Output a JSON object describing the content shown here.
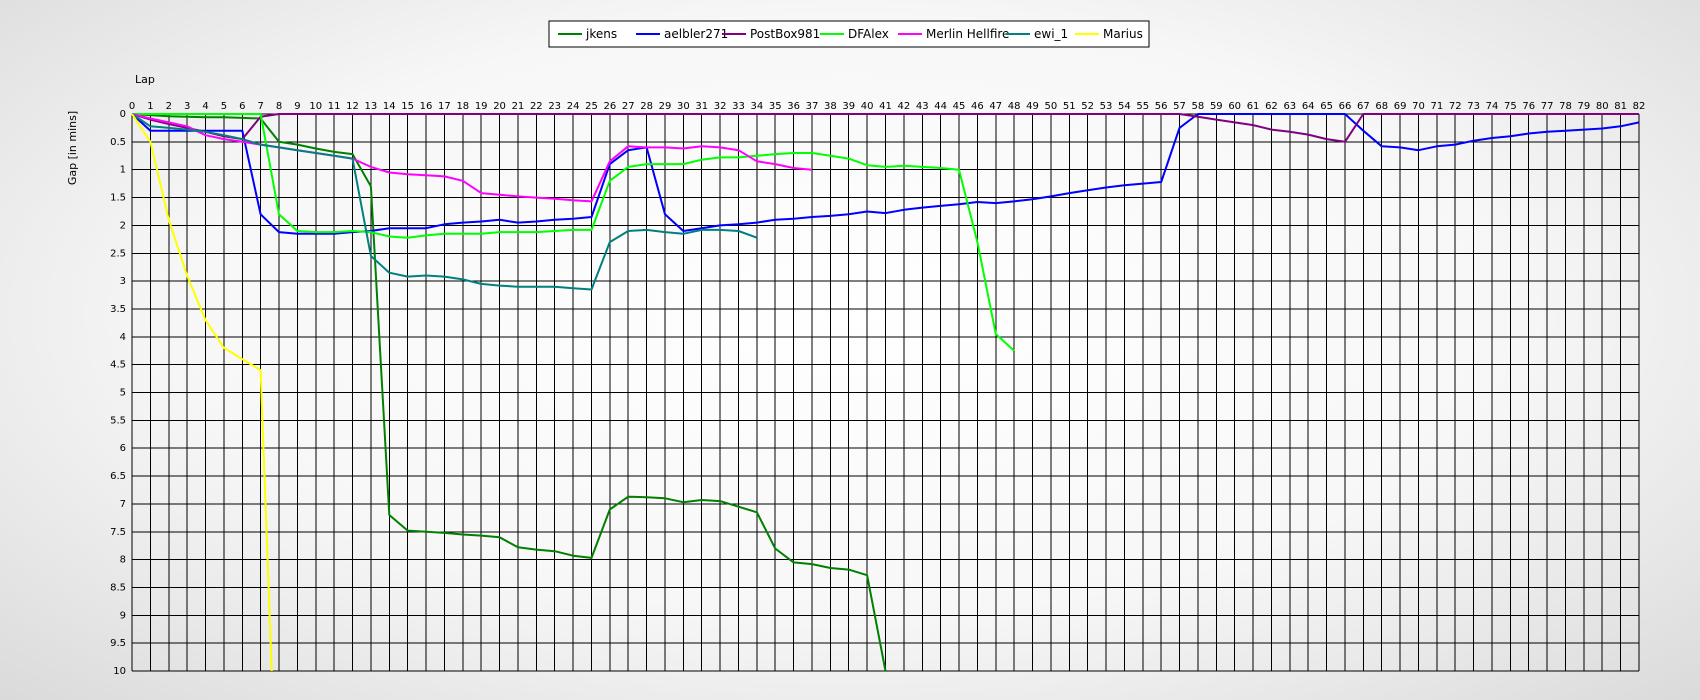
{
  "chart_data": {
    "type": "line",
    "title": "",
    "xlabel": "Lap",
    "ylabel": "Gap [in mins]",
    "xlim": [
      0,
      82
    ],
    "ylim": [
      0,
      10
    ],
    "y_inverted": true,
    "x_ticks": [
      0,
      1,
      2,
      3,
      4,
      5,
      6,
      7,
      8,
      9,
      10,
      11,
      12,
      13,
      14,
      15,
      16,
      17,
      18,
      19,
      20,
      21,
      22,
      23,
      24,
      25,
      26,
      27,
      28,
      29,
      30,
      31,
      32,
      33,
      34,
      35,
      36,
      37,
      38,
      39,
      40,
      41,
      42,
      43,
      44,
      45,
      46,
      47,
      48,
      49,
      50,
      51,
      52,
      53,
      54,
      55,
      56,
      57,
      58,
      59,
      60,
      61,
      62,
      63,
      64,
      65,
      66,
      67,
      68,
      69,
      70,
      71,
      72,
      73,
      74,
      75,
      76,
      77,
      78,
      79,
      80,
      81,
      82
    ],
    "y_ticks": [
      "0",
      "0.5",
      "1",
      "1.5",
      "2",
      "2.5",
      "3",
      "3.5",
      "4",
      "4.5",
      "5",
      "5.5",
      "6",
      "6.5",
      "7",
      "7.5",
      "8",
      "8.5",
      "9",
      "9.5",
      "10"
    ],
    "grid": true,
    "legend_position": "top-center",
    "series": [
      {
        "name": "jkens",
        "color": "#008000",
        "points": [
          [
            0,
            0
          ],
          [
            1,
            0.02
          ],
          [
            2,
            0.04
          ],
          [
            3,
            0.05
          ],
          [
            4,
            0.06
          ],
          [
            5,
            0.06
          ],
          [
            6,
            0.07
          ],
          [
            7,
            0.08
          ],
          [
            8,
            0.5
          ],
          [
            9,
            0.55
          ],
          [
            10,
            0.62
          ],
          [
            11,
            0.68
          ],
          [
            12,
            0.72
          ],
          [
            13,
            1.3
          ],
          [
            14,
            7.2
          ],
          [
            15,
            7.48
          ],
          [
            16,
            7.5
          ],
          [
            17,
            7.52
          ],
          [
            18,
            7.55
          ],
          [
            19,
            7.57
          ],
          [
            20,
            7.6
          ],
          [
            21,
            7.78
          ],
          [
            22,
            7.82
          ],
          [
            23,
            7.85
          ],
          [
            24,
            7.93
          ],
          [
            25,
            7.97
          ],
          [
            26,
            7.1
          ],
          [
            27,
            6.87
          ],
          [
            28,
            6.88
          ],
          [
            29,
            6.9
          ],
          [
            30,
            6.97
          ],
          [
            31,
            6.93
          ],
          [
            32,
            6.95
          ],
          [
            33,
            7.05
          ],
          [
            34,
            7.15
          ],
          [
            35,
            7.8
          ],
          [
            36,
            8.05
          ],
          [
            37,
            8.08
          ],
          [
            38,
            8.15
          ],
          [
            39,
            8.18
          ],
          [
            40,
            8.28
          ],
          [
            41,
            10
          ]
        ]
      },
      {
        "name": "aelbler271",
        "color": "#0000ff",
        "points": [
          [
            0,
            0
          ],
          [
            1,
            0.3
          ],
          [
            2,
            0.3
          ],
          [
            3,
            0.3
          ],
          [
            4,
            0.3
          ],
          [
            5,
            0.3
          ],
          [
            6,
            0.3
          ],
          [
            7,
            1.8
          ],
          [
            8,
            2.12
          ],
          [
            9,
            2.15
          ],
          [
            10,
            2.15
          ],
          [
            11,
            2.15
          ],
          [
            12,
            2.12
          ],
          [
            13,
            2.1
          ],
          [
            14,
            2.05
          ],
          [
            15,
            2.05
          ],
          [
            16,
            2.05
          ],
          [
            17,
            1.98
          ],
          [
            18,
            1.95
          ],
          [
            19,
            1.93
          ],
          [
            20,
            1.9
          ],
          [
            21,
            1.95
          ],
          [
            22,
            1.93
          ],
          [
            23,
            1.9
          ],
          [
            24,
            1.88
          ],
          [
            25,
            1.85
          ],
          [
            26,
            0.9
          ],
          [
            27,
            0.65
          ],
          [
            28,
            0.6
          ],
          [
            29,
            1.8
          ],
          [
            30,
            2.1
          ],
          [
            31,
            2.05
          ],
          [
            32,
            2
          ],
          [
            33,
            1.98
          ],
          [
            34,
            1.95
          ],
          [
            35,
            1.9
          ],
          [
            36,
            1.88
          ],
          [
            37,
            1.85
          ],
          [
            38,
            1.83
          ],
          [
            39,
            1.8
          ],
          [
            40,
            1.75
          ],
          [
            41,
            1.78
          ],
          [
            42,
            1.72
          ],
          [
            43,
            1.68
          ],
          [
            44,
            1.65
          ],
          [
            45,
            1.62
          ],
          [
            46,
            1.58
          ],
          [
            47,
            1.6
          ],
          [
            48,
            1.57
          ],
          [
            49,
            1.53
          ],
          [
            50,
            1.48
          ],
          [
            51,
            1.42
          ],
          [
            52,
            1.37
          ],
          [
            53,
            1.32
          ],
          [
            54,
            1.28
          ],
          [
            55,
            1.25
          ],
          [
            56,
            1.22
          ],
          [
            57,
            0.25
          ],
          [
            58,
            0
          ],
          [
            59,
            0
          ],
          [
            60,
            0
          ],
          [
            61,
            0
          ],
          [
            62,
            0
          ],
          [
            63,
            0
          ],
          [
            64,
            0
          ],
          [
            65,
            0
          ],
          [
            66,
            0
          ],
          [
            67,
            0.3
          ],
          [
            68,
            0.58
          ],
          [
            69,
            0.6
          ],
          [
            70,
            0.65
          ],
          [
            71,
            0.58
          ],
          [
            72,
            0.55
          ],
          [
            73,
            0.48
          ],
          [
            74,
            0.43
          ],
          [
            75,
            0.4
          ],
          [
            76,
            0.35
          ],
          [
            77,
            0.32
          ],
          [
            78,
            0.3
          ],
          [
            79,
            0.28
          ],
          [
            80,
            0.26
          ],
          [
            81,
            0.22
          ],
          [
            82,
            0.15
          ]
        ]
      },
      {
        "name": "PostBox981",
        "color": "#800080",
        "points": [
          [
            0,
            0
          ],
          [
            1,
            0.1
          ],
          [
            2,
            0.18
          ],
          [
            3,
            0.25
          ],
          [
            4,
            0.32
          ],
          [
            5,
            0.4
          ],
          [
            6,
            0.45
          ],
          [
            7,
            0.05
          ],
          [
            8,
            0
          ],
          [
            57,
            0
          ],
          [
            58,
            0.05
          ],
          [
            59,
            0.1
          ],
          [
            60,
            0.15
          ],
          [
            61,
            0.2
          ],
          [
            62,
            0.28
          ],
          [
            63,
            0.32
          ],
          [
            64,
            0.37
          ],
          [
            65,
            0.45
          ],
          [
            66,
            0.5
          ],
          [
            67,
            0
          ],
          [
            82,
            0
          ]
        ]
      },
      {
        "name": "DFAlex",
        "color": "#00ff00",
        "points": [
          [
            0,
            0
          ],
          [
            1,
            0
          ],
          [
            2,
            0
          ],
          [
            3,
            0
          ],
          [
            4,
            0
          ],
          [
            5,
            0
          ],
          [
            6,
            0
          ],
          [
            7,
            0
          ],
          [
            8,
            1.8
          ],
          [
            9,
            2.1
          ],
          [
            10,
            2.12
          ],
          [
            11,
            2.12
          ],
          [
            12,
            2.1
          ],
          [
            13,
            2.12
          ],
          [
            14,
            2.2
          ],
          [
            15,
            2.22
          ],
          [
            16,
            2.18
          ],
          [
            17,
            2.15
          ],
          [
            18,
            2.15
          ],
          [
            19,
            2.15
          ],
          [
            20,
            2.12
          ],
          [
            21,
            2.12
          ],
          [
            22,
            2.12
          ],
          [
            23,
            2.1
          ],
          [
            24,
            2.08
          ],
          [
            25,
            2.08
          ],
          [
            26,
            1.2
          ],
          [
            27,
            0.95
          ],
          [
            28,
            0.9
          ],
          [
            29,
            0.9
          ],
          [
            30,
            0.9
          ],
          [
            31,
            0.82
          ],
          [
            32,
            0.78
          ],
          [
            33,
            0.78
          ],
          [
            34,
            0.75
          ],
          [
            35,
            0.72
          ],
          [
            36,
            0.7
          ],
          [
            37,
            0.7
          ],
          [
            38,
            0.75
          ],
          [
            39,
            0.8
          ],
          [
            40,
            0.92
          ],
          [
            41,
            0.95
          ],
          [
            42,
            0.93
          ],
          [
            43,
            0.95
          ],
          [
            44,
            0.97
          ],
          [
            45,
            1
          ],
          [
            46,
            2.3
          ],
          [
            47,
            3.95
          ],
          [
            48,
            4.25
          ]
        ]
      },
      {
        "name": "Merlin Hellfire",
        "color": "#ff00ff",
        "points": [
          [
            0,
            0
          ],
          [
            1,
            0.08
          ],
          [
            2,
            0.15
          ],
          [
            3,
            0.22
          ],
          [
            4,
            0.38
          ],
          [
            5,
            0.45
          ],
          [
            6,
            0.5
          ],
          [
            7,
            0.55
          ],
          [
            8,
            0.6
          ],
          [
            9,
            0.65
          ],
          [
            10,
            0.7
          ],
          [
            11,
            0.75
          ],
          [
            12,
            0.8
          ],
          [
            13,
            0.95
          ],
          [
            14,
            1.05
          ],
          [
            15,
            1.08
          ],
          [
            16,
            1.1
          ],
          [
            17,
            1.12
          ],
          [
            18,
            1.2
          ],
          [
            19,
            1.42
          ],
          [
            20,
            1.45
          ],
          [
            21,
            1.48
          ],
          [
            22,
            1.5
          ],
          [
            23,
            1.52
          ],
          [
            24,
            1.55
          ],
          [
            25,
            1.57
          ],
          [
            26,
            0.85
          ],
          [
            27,
            0.58
          ],
          [
            28,
            0.6
          ],
          [
            29,
            0.6
          ],
          [
            30,
            0.62
          ],
          [
            31,
            0.58
          ],
          [
            32,
            0.6
          ],
          [
            33,
            0.65
          ],
          [
            34,
            0.85
          ],
          [
            35,
            0.9
          ],
          [
            36,
            0.97
          ],
          [
            37,
            1
          ]
        ]
      },
      {
        "name": "ewi_1",
        "color": "#008080",
        "points": [
          [
            0,
            0
          ],
          [
            1,
            0.22
          ],
          [
            2,
            0.25
          ],
          [
            3,
            0.28
          ],
          [
            4,
            0.32
          ],
          [
            5,
            0.38
          ],
          [
            6,
            0.45
          ],
          [
            7,
            0.55
          ],
          [
            8,
            0.6
          ],
          [
            9,
            0.65
          ],
          [
            10,
            0.7
          ],
          [
            11,
            0.75
          ],
          [
            12,
            0.8
          ],
          [
            13,
            2.55
          ],
          [
            14,
            2.85
          ],
          [
            15,
            2.92
          ],
          [
            16,
            2.9
          ],
          [
            17,
            2.92
          ],
          [
            18,
            2.97
          ],
          [
            19,
            3.05
          ],
          [
            20,
            3.08
          ],
          [
            21,
            3.1
          ],
          [
            22,
            3.1
          ],
          [
            23,
            3.1
          ],
          [
            24,
            3.13
          ],
          [
            25,
            3.15
          ],
          [
            26,
            2.3
          ],
          [
            27,
            2.1
          ],
          [
            28,
            2.08
          ],
          [
            29,
            2.12
          ],
          [
            30,
            2.15
          ],
          [
            31,
            2.08
          ],
          [
            32,
            2.08
          ],
          [
            33,
            2.1
          ],
          [
            34,
            2.22
          ]
        ]
      },
      {
        "name": "Marius",
        "color": "#ffff00",
        "points": [
          [
            0,
            0
          ],
          [
            1,
            0.5
          ],
          [
            2,
            1.9
          ],
          [
            3,
            2.9
          ],
          [
            4,
            3.7
          ],
          [
            5,
            4.2
          ],
          [
            6,
            4.4
          ],
          [
            7,
            4.6
          ],
          [
            7.6,
            10
          ]
        ]
      }
    ]
  }
}
